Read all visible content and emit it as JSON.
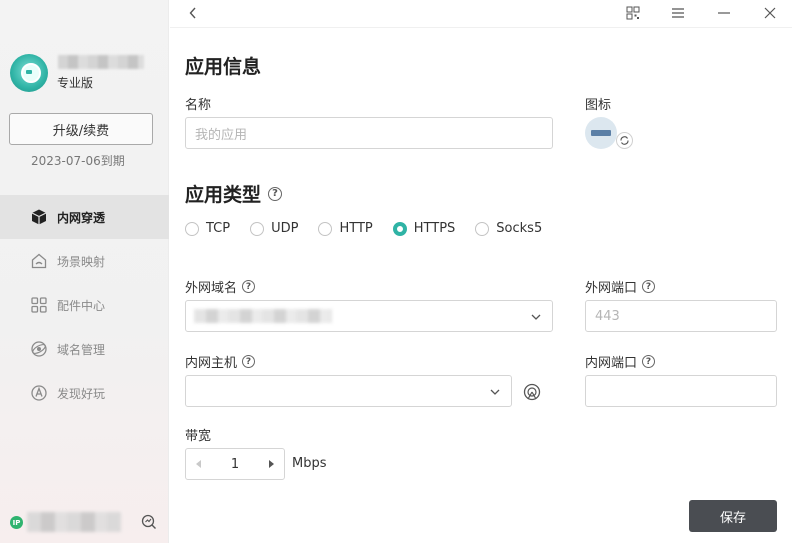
{
  "sidebar": {
    "edition": "专业版",
    "upgrade_label": "升级/续费",
    "expiry": "2023-07-06到期",
    "items": [
      {
        "label": "内网穿透",
        "icon": "cube-icon"
      },
      {
        "label": "场景映射",
        "icon": "house-icon"
      },
      {
        "label": "配件中心",
        "icon": "grid-icon"
      },
      {
        "label": "域名管理",
        "icon": "globe-icon"
      },
      {
        "label": "发现好玩",
        "icon": "compass-icon"
      }
    ],
    "ip_badge": "IP"
  },
  "titlebar": {
    "icons": [
      "back-icon",
      "qrcode-icon",
      "menu-icon",
      "minimize-icon",
      "close-icon"
    ]
  },
  "form": {
    "section1_title": "应用信息",
    "name_label": "名称",
    "name_placeholder": "我的应用",
    "icon_label": "图标",
    "section2_title": "应用类型",
    "types": [
      "TCP",
      "UDP",
      "HTTP",
      "HTTPS",
      "Socks5"
    ],
    "selected_type": "HTTPS",
    "ext_domain_label": "外网域名",
    "ext_port_label": "外网端口",
    "ext_port_placeholder": "443",
    "int_host_label": "内网主机",
    "int_port_label": "内网端口",
    "bandwidth_label": "带宽",
    "bandwidth_value": "1",
    "bandwidth_unit": "Mbps",
    "save_label": "保存"
  },
  "colors": {
    "accent": "#2fb3a5",
    "save_button": "#4a4d52"
  }
}
